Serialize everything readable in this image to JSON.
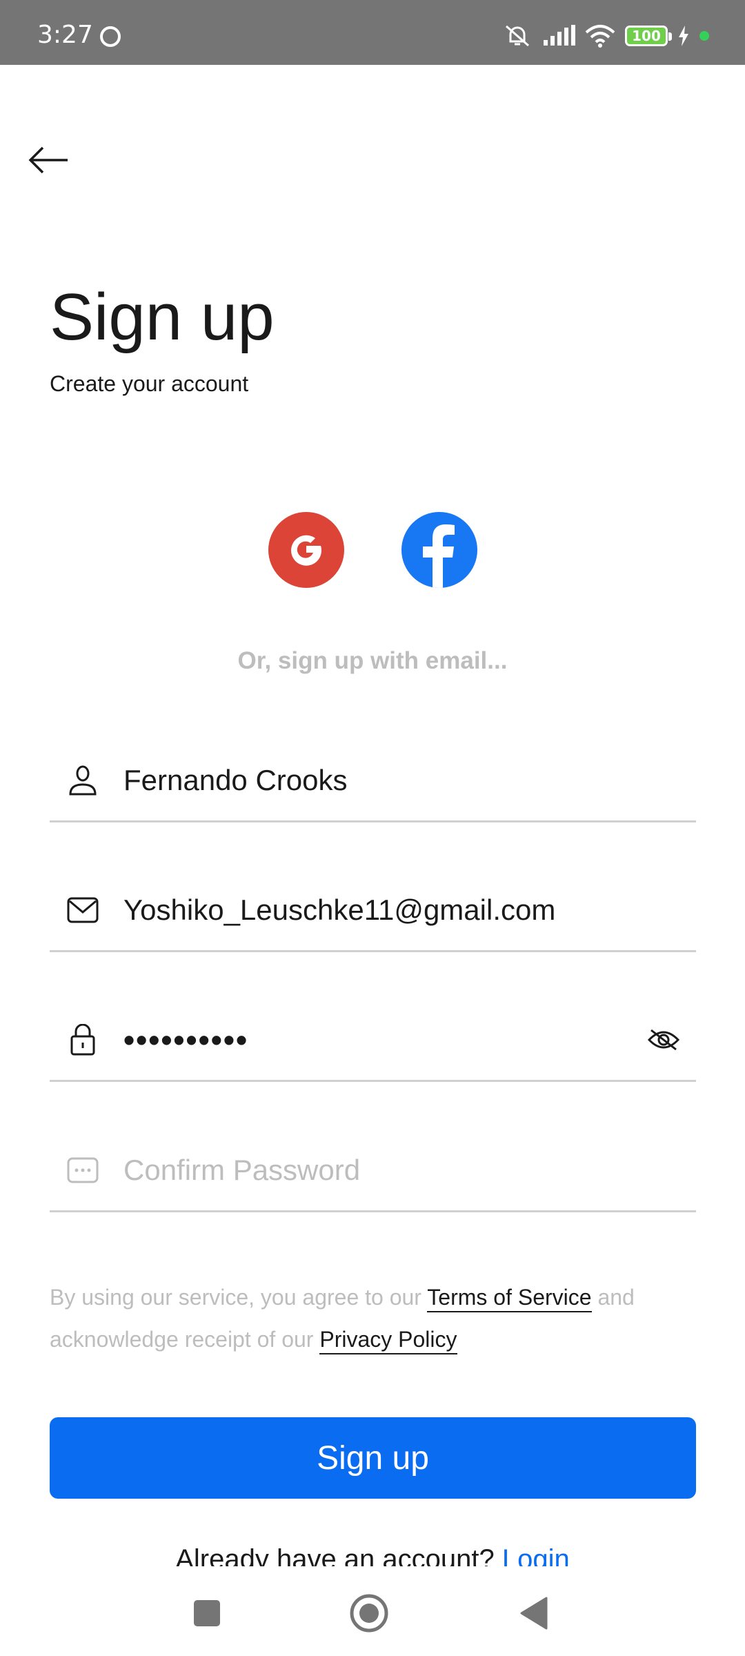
{
  "status_bar": {
    "time": "3:27",
    "battery": "100",
    "icons": [
      "face-icon",
      "mute-icon",
      "signal-icon",
      "wifi-icon",
      "battery-icon",
      "charging-icon"
    ]
  },
  "header": {
    "back_icon": "arrow-left-icon"
  },
  "page": {
    "title": "Sign up",
    "subtitle": "Create your account"
  },
  "social": {
    "google_label": "G",
    "facebook_label": "f",
    "divider_text": "Or, sign up with email..."
  },
  "form": {
    "name": {
      "value": "Fernando Crooks",
      "icon": "person-icon"
    },
    "email": {
      "value": "Yoshiko_Leuschke11@gmail.com",
      "icon": "mail-icon"
    },
    "password": {
      "value": "••••••••••",
      "icon": "lock-icon",
      "toggle_icon": "eye-off-icon"
    },
    "confirm_password": {
      "placeholder": "Confirm Password",
      "icon": "password-dots-icon"
    }
  },
  "terms": {
    "prefix": "By using our service, you agree to our",
    "terms_link": "Terms of Service",
    "middle": "and acknowledge receipt of our",
    "privacy_link": "Privacy Policy"
  },
  "actions": {
    "signup_label": "Sign up",
    "login_prompt": "Already have an account?",
    "login_link": "Login"
  },
  "colors": {
    "primary": "#0a6cf0",
    "google": "#db4437",
    "facebook": "#1877f2",
    "status_bar": "#757575"
  }
}
